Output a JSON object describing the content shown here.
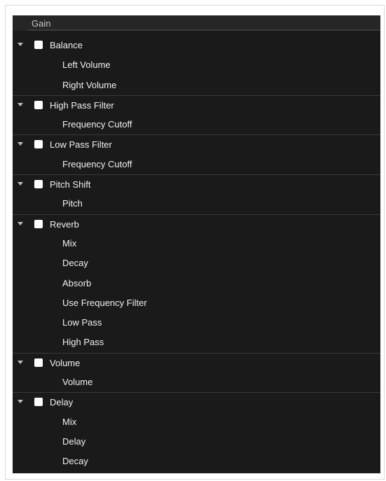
{
  "header": {
    "label": "Gain"
  },
  "groups": [
    {
      "name": "Balance",
      "params": [
        "Left Volume",
        "Right Volume"
      ]
    },
    {
      "name": "High Pass Filter",
      "params": [
        "Frequency Cutoff"
      ]
    },
    {
      "name": "Low Pass Filter",
      "params": [
        "Frequency Cutoff"
      ]
    },
    {
      "name": "Pitch Shift",
      "params": [
        "Pitch"
      ]
    },
    {
      "name": "Reverb",
      "params": [
        "Mix",
        "Decay",
        "Absorb",
        "Use Frequency Filter",
        "Low Pass",
        "High Pass"
      ]
    },
    {
      "name": "Volume",
      "params": [
        "Volume"
      ]
    },
    {
      "name": "Delay",
      "params": [
        "Mix",
        "Delay",
        "Decay"
      ]
    }
  ],
  "colors": {
    "panel_bg": "#1a1a1a",
    "text": "#f0f0f0",
    "divider": "#3a3a3a",
    "checkbox": "#ffffff"
  }
}
